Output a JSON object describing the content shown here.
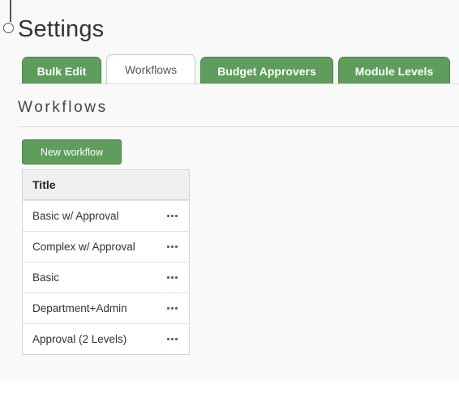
{
  "header": {
    "title": "Settings"
  },
  "tabs": [
    {
      "label": "Bulk Edit",
      "active": false
    },
    {
      "label": "Workflows",
      "active": true
    },
    {
      "label": "Budget Approvers",
      "active": false
    },
    {
      "label": "Module Levels",
      "active": false
    }
  ],
  "section": {
    "title": "Workflows",
    "new_button_label": "New workflow"
  },
  "table": {
    "header": "Title",
    "rows": [
      {
        "title": "Basic w/ Approval",
        "menu_icon": "ellipsis-icon"
      },
      {
        "title": "Complex w/ Approval",
        "menu_icon": "ellipsis-icon"
      },
      {
        "title": "Basic",
        "menu_icon": "ellipsis-icon"
      },
      {
        "title": "Department+Admin",
        "menu_icon": "ellipsis-icon"
      },
      {
        "title": "Approval (2 Levels)",
        "menu_icon": "ellipsis-icon"
      }
    ]
  },
  "colors": {
    "accent_green": "#5e9d5b",
    "icon_green": "#3d7a3a",
    "page_background": "#f9f9f9"
  }
}
